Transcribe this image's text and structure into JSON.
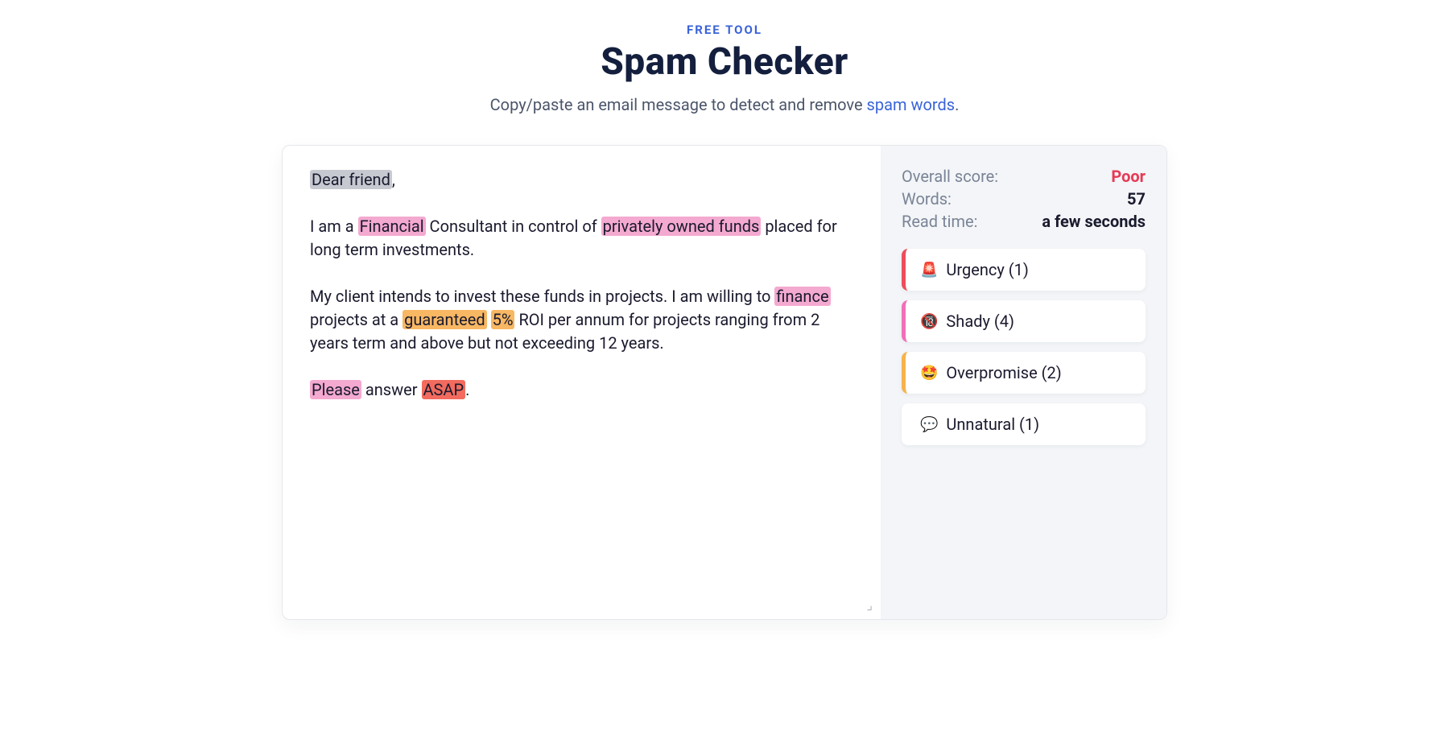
{
  "header": {
    "eyebrow": "FREE TOOL",
    "title": "Spam Checker",
    "subtitle_pre": "Copy/paste an email message to detect and remove ",
    "subtitle_link": "spam words",
    "subtitle_post": "."
  },
  "editor": {
    "segments": [
      {
        "text": "Dear friend",
        "hl": "gray"
      },
      {
        "text": ",",
        "hl": null
      },
      {
        "br": 2
      },
      {
        "text": "  I am a ",
        "hl": null
      },
      {
        "text": "Financial",
        "hl": "pink"
      },
      {
        "text": " Consultant in control of ",
        "hl": null
      },
      {
        "text": "privately owned funds",
        "hl": "pink"
      },
      {
        "text": " placed for long term investments.",
        "hl": null
      },
      {
        "br": 2
      },
      {
        "text": "  My client intends to invest these funds in projects. I am willing to ",
        "hl": null
      },
      {
        "text": "finance",
        "hl": "pink"
      },
      {
        "text": " projects at a ",
        "hl": null
      },
      {
        "text": "guaranteed",
        "hl": "orange"
      },
      {
        "text": " ",
        "hl": null
      },
      {
        "text": "5%",
        "hl": "orange"
      },
      {
        "text": " ROI per annum for projects ranging from 2 years term and above but not exceeding 12 years.",
        "hl": null
      },
      {
        "br": 2
      },
      {
        "text": " ",
        "hl": null
      },
      {
        "text": "Please",
        "hl": "pink"
      },
      {
        "text": " answer ",
        "hl": null
      },
      {
        "text": "ASAP",
        "hl": "red"
      },
      {
        "text": ".",
        "hl": null
      }
    ]
  },
  "sidebar": {
    "stats": {
      "overall_label": "Overall score:",
      "overall_value": "Poor",
      "words_label": "Words:",
      "words_value": "57",
      "readtime_label": "Read time:",
      "readtime_value": "a few seconds"
    },
    "categories": [
      {
        "key": "urgency",
        "emoji": "🚨",
        "label": "Urgency",
        "count": 1
      },
      {
        "key": "shady",
        "emoji": "🔞",
        "label": "Shady",
        "count": 4
      },
      {
        "key": "overpromise",
        "emoji": "🤩",
        "label": "Overpromise",
        "count": 2
      },
      {
        "key": "unnatural",
        "emoji": "💬",
        "label": "Unnatural",
        "count": 1
      }
    ]
  }
}
